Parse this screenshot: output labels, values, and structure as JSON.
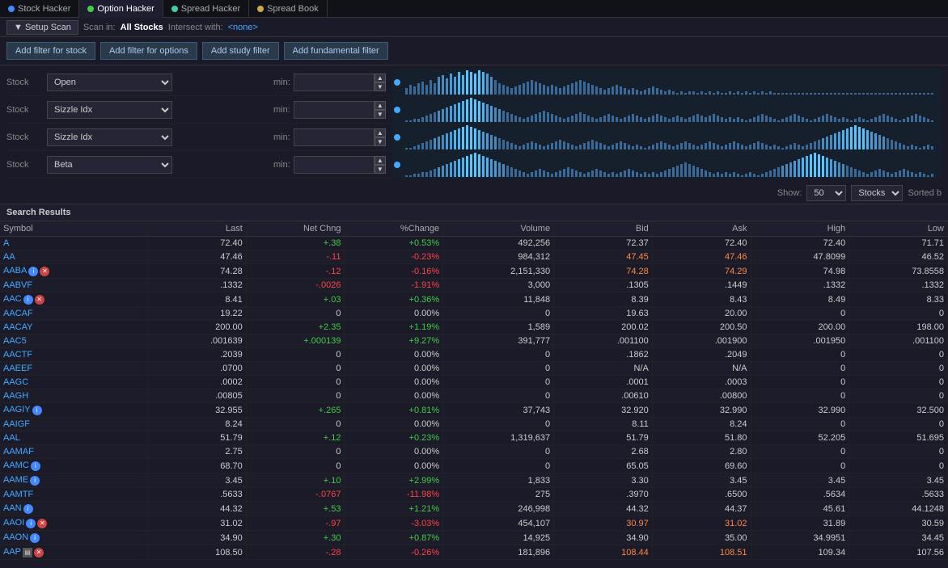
{
  "tabs": [
    {
      "id": "stock-hacker",
      "label": "Stock Hacker",
      "dot": "blue",
      "active": false
    },
    {
      "id": "option-hacker",
      "label": "Option Hacker",
      "dot": "green",
      "active": true
    },
    {
      "id": "spread-hacker",
      "label": "Spread Hacker",
      "dot": "teal",
      "active": false
    },
    {
      "id": "spread-book",
      "label": "Spread Book",
      "dot": "yellow",
      "active": false
    }
  ],
  "setup_bar": {
    "setup_label": "Setup Scan",
    "scan_in_prefix": "Scan in:",
    "scan_in_value": "All Stocks",
    "intersect_prefix": "Intersect with:",
    "intersect_value": "<none>"
  },
  "filter_buttons": [
    "Add filter for stock",
    "Add filter for options",
    "Add study filter",
    "Add fundamental filter"
  ],
  "filter_rows": [
    {
      "label": "Stock",
      "select": "Open",
      "min_label": "min:"
    },
    {
      "label": "Stock",
      "select": "Sizzle Idx",
      "min_label": "min:"
    },
    {
      "label": "Stock",
      "select": "Sizzle Idx",
      "min_label": "min:"
    },
    {
      "label": "Stock",
      "select": "Beta",
      "min_label": "min:"
    }
  ],
  "show_bar": {
    "show_label": "Show:",
    "show_value": "50",
    "type_value": "Stocks",
    "sorted_label": "Sorted b"
  },
  "results_header": "Search Results",
  "table": {
    "columns": [
      "Symbol",
      "Last",
      "Net Chng",
      "%Change",
      "Volume",
      "Bid",
      "Ask",
      "High",
      "Low"
    ],
    "rows": [
      {
        "symbol": "A",
        "last": "72.40",
        "net": "+.38",
        "pct": "+0.53%",
        "vol": "492,256",
        "bid": "72.37",
        "ask": "72.40",
        "high": "72.40",
        "low": "71.71",
        "net_class": "positive",
        "pct_class": "positive"
      },
      {
        "symbol": "AA",
        "last": "47.46",
        "net": "-.11",
        "pct": "-0.23%",
        "vol": "984,312",
        "bid": "47.45",
        "ask": "47.46",
        "high": "47.8099",
        "low": "46.52",
        "net_class": "negative",
        "pct_class": "negative"
      },
      {
        "symbol": "AABA",
        "last": "74.28",
        "net": "-.12",
        "pct": "-0.16%",
        "vol": "2,151,330",
        "bid": "74.28",
        "ask": "74.29",
        "high": "74.98",
        "low": "73.8558",
        "net_class": "negative",
        "pct_class": "negative",
        "icons": [
          "info",
          "del"
        ]
      },
      {
        "symbol": "AABVF",
        "last": ".1332",
        "net": "-.0026",
        "pct": "-1.91%",
        "vol": "3,000",
        "bid": ".1305",
        "ask": ".1449",
        "high": ".1332",
        "low": ".1332",
        "net_class": "negative",
        "pct_class": "negative"
      },
      {
        "symbol": "AAC",
        "last": "8.41",
        "net": "+.03",
        "pct": "+0.36%",
        "vol": "11,848",
        "bid": "8.39",
        "ask": "8.43",
        "high": "8.49",
        "low": "8.33",
        "net_class": "positive",
        "pct_class": "positive",
        "icons": [
          "info",
          "del"
        ]
      },
      {
        "symbol": "AACAF",
        "last": "19.22",
        "net": "0",
        "pct": "0.00%",
        "vol": "0",
        "bid": "19.63",
        "ask": "20.00",
        "high": "0",
        "low": "0",
        "net_class": "neutral",
        "pct_class": "neutral"
      },
      {
        "symbol": "AACAY",
        "last": "200.00",
        "net": "+2.35",
        "pct": "+1.19%",
        "vol": "1,589",
        "bid": "200.02",
        "ask": "200.50",
        "high": "200.00",
        "low": "198.00",
        "net_class": "positive",
        "pct_class": "positive"
      },
      {
        "symbol": "AAC5",
        "last": ".001639",
        "net": "+.000139",
        "pct": "+9.27%",
        "vol": "391,777",
        "bid": ".001100",
        "ask": ".001900",
        "high": ".001950",
        "low": ".001100",
        "net_class": "positive",
        "pct_class": "positive"
      },
      {
        "symbol": "AACTF",
        "last": ".2039",
        "net": "0",
        "pct": "0.00%",
        "vol": "0",
        "bid": ".1862",
        "ask": ".2049",
        "high": "0",
        "low": "0",
        "net_class": "neutral",
        "pct_class": "neutral"
      },
      {
        "symbol": "AAEEF",
        "last": ".0700",
        "net": "0",
        "pct": "0.00%",
        "vol": "0",
        "bid": "N/A",
        "ask": "N/A",
        "high": "0",
        "low": "0",
        "net_class": "neutral",
        "pct_class": "neutral"
      },
      {
        "symbol": "AAGC",
        "last": ".0002",
        "net": "0",
        "pct": "0.00%",
        "vol": "0",
        "bid": ".0001",
        "ask": ".0003",
        "high": "0",
        "low": "0",
        "net_class": "neutral",
        "pct_class": "neutral"
      },
      {
        "symbol": "AAGH",
        "last": ".00805",
        "net": "0",
        "pct": "0.00%",
        "vol": "0",
        "bid": ".00610",
        "ask": ".00800",
        "high": "0",
        "low": "0",
        "net_class": "neutral",
        "pct_class": "neutral"
      },
      {
        "symbol": "AAGIY",
        "last": "32.955",
        "net": "+.265",
        "pct": "+0.81%",
        "vol": "37,743",
        "bid": "32.920",
        "ask": "32.990",
        "high": "32.990",
        "low": "32.500",
        "net_class": "positive",
        "pct_class": "positive",
        "icons": [
          "info"
        ]
      },
      {
        "symbol": "AAIGF",
        "last": "8.24",
        "net": "0",
        "pct": "0.00%",
        "vol": "0",
        "bid": "8.11",
        "ask": "8.24",
        "high": "0",
        "low": "0",
        "net_class": "neutral",
        "pct_class": "neutral"
      },
      {
        "symbol": "AAL",
        "last": "51.79",
        "net": "+.12",
        "pct": "+0.23%",
        "vol": "1,319,637",
        "bid": "51.79",
        "ask": "51.80",
        "high": "52.205",
        "low": "51.695",
        "net_class": "positive",
        "pct_class": "positive"
      },
      {
        "symbol": "AAMAF",
        "last": "2.75",
        "net": "0",
        "pct": "0.00%",
        "vol": "0",
        "bid": "2.68",
        "ask": "2.80",
        "high": "0",
        "low": "0",
        "net_class": "neutral",
        "pct_class": "neutral"
      },
      {
        "symbol": "AAMC",
        "last": "68.70",
        "net": "0",
        "pct": "0.00%",
        "vol": "0",
        "bid": "65.05",
        "ask": "69.60",
        "high": "0",
        "low": "0",
        "net_class": "neutral",
        "pct_class": "neutral",
        "icons": [
          "info"
        ]
      },
      {
        "symbol": "AAME",
        "last": "3.45",
        "net": "+.10",
        "pct": "+2.99%",
        "vol": "1,833",
        "bid": "3.30",
        "ask": "3.45",
        "high": "3.45",
        "low": "3.45",
        "net_class": "positive",
        "pct_class": "positive",
        "icons": [
          "info"
        ]
      },
      {
        "symbol": "AAMTF",
        "last": ".5633",
        "net": "-.0767",
        "pct": "-11.98%",
        "vol": "275",
        "bid": ".3970",
        "ask": ".6500",
        "high": ".5634",
        "low": ".5633",
        "net_class": "negative",
        "pct_class": "negative"
      },
      {
        "symbol": "AAN",
        "last": "44.32",
        "net": "+.53",
        "pct": "+1.21%",
        "vol": "246,998",
        "bid": "44.32",
        "ask": "44.37",
        "high": "45.61",
        "low": "44.1248",
        "net_class": "positive",
        "pct_class": "positive",
        "icons": [
          "info"
        ]
      },
      {
        "symbol": "AAOI",
        "last": "31.02",
        "net": "-.97",
        "pct": "-3.03%",
        "vol": "454,107",
        "bid": "30.97",
        "ask": "31.02",
        "high": "31.89",
        "low": "30.59",
        "net_class": "negative",
        "pct_class": "negative",
        "icons": [
          "info",
          "del"
        ]
      },
      {
        "symbol": "AAON",
        "last": "34.90",
        "net": "+.30",
        "pct": "+0.87%",
        "vol": "14,925",
        "bid": "34.90",
        "ask": "35.00",
        "high": "34.9951",
        "low": "34.45",
        "net_class": "positive",
        "pct_class": "positive",
        "icons": [
          "info"
        ]
      },
      {
        "symbol": "AAP",
        "last": "108.50",
        "net": "-.28",
        "pct": "-0.26%",
        "vol": "181,896",
        "bid": "108.44",
        "ask": "108.51",
        "high": "109.34",
        "low": "107.56",
        "net_class": "negative",
        "pct_class": "negative",
        "icons": [
          "box",
          "del"
        ]
      }
    ]
  },
  "colors": {
    "positive": "#44cc44",
    "negative": "#ff4444",
    "neutral": "#cccccc",
    "orange": "#ff8844"
  }
}
